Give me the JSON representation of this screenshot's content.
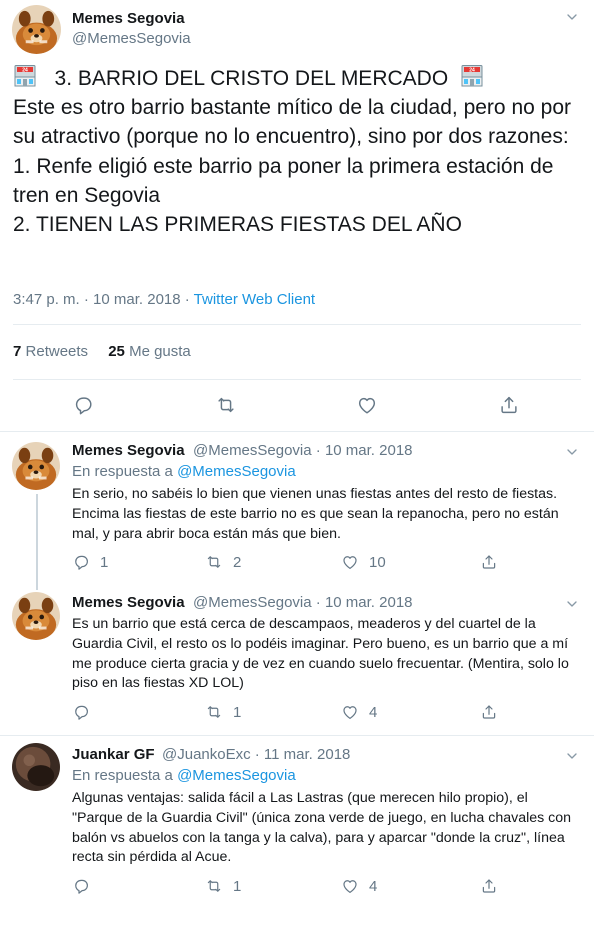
{
  "main": {
    "author_name": "Memes Segovia",
    "author_handle": "@MemesSegovia",
    "text_heading": "3. BARRIO DEL CRISTO DEL MERCADO",
    "text_body": "Este es otro barrio bastante mítico de la ciudad, pero no por su atractivo (porque no lo encuentro), sino por dos razones:\n1. Renfe eligió este barrio pa poner la primera estación de tren en Segovia\n2. TIENEN LAS PRIMERAS FIESTAS DEL AÑO",
    "emoji_icon": "station-emoji-icon",
    "time": "3:47 p. m. · 10 mar. 2018 · ",
    "client": "Twitter Web Client",
    "retweets_count": "7",
    "retweets_label": "Retweets",
    "likes_count": "25",
    "likes_label": "Me gusta"
  },
  "replies": [
    {
      "author_name": "Memes Segovia",
      "meta": "@MemesSegovia · 10 mar. 2018",
      "in_reply_prefix": "En respuesta a ",
      "in_reply_handle": "@MemesSegovia",
      "text": "En serio, no sabéis lo bien que vienen unas fiestas antes del resto de fiestas. Encima las fiestas de este barrio no es que sean la repanocha, pero no están mal, y para abrir boca están más que bien.",
      "reply_count": "1",
      "retweet_count": "2",
      "like_count": "10"
    },
    {
      "author_name": "Memes Segovia",
      "meta": "@MemesSegovia · 10 mar. 2018",
      "text": "Es un barrio que está cerca de descampaos, meaderos y del cuartel de la Guardia Civil, el resto os lo podéis imaginar. Pero bueno, es un barrio que a mí me produce cierta gracia y de vez en cuando suelo frecuentar. (Mentira, solo lo piso en las fiestas XD LOL)",
      "retweet_count": "1",
      "like_count": "4"
    },
    {
      "author_name": "Juankar GF",
      "meta": "@JuankoExc · 11 mar. 2018",
      "in_reply_prefix": "En respuesta a ",
      "in_reply_handle": "@MemesSegovia",
      "text": "Algunas ventajas: salida fácil a Las Lastras (que merecen hilo propio), el \"Parque de la Guardia Civil\" (única zona verde de juego, en lucha chavales con balón vs abuelos con la tanga y la calva), para y aparcar \"donde la cruz\", línea recta sin pérdida al Acue.",
      "retweet_count": "1",
      "like_count": "4"
    }
  ],
  "colors": {
    "link": "#1b95e0",
    "secondary": "#657786",
    "border": "#e6ecf0"
  }
}
